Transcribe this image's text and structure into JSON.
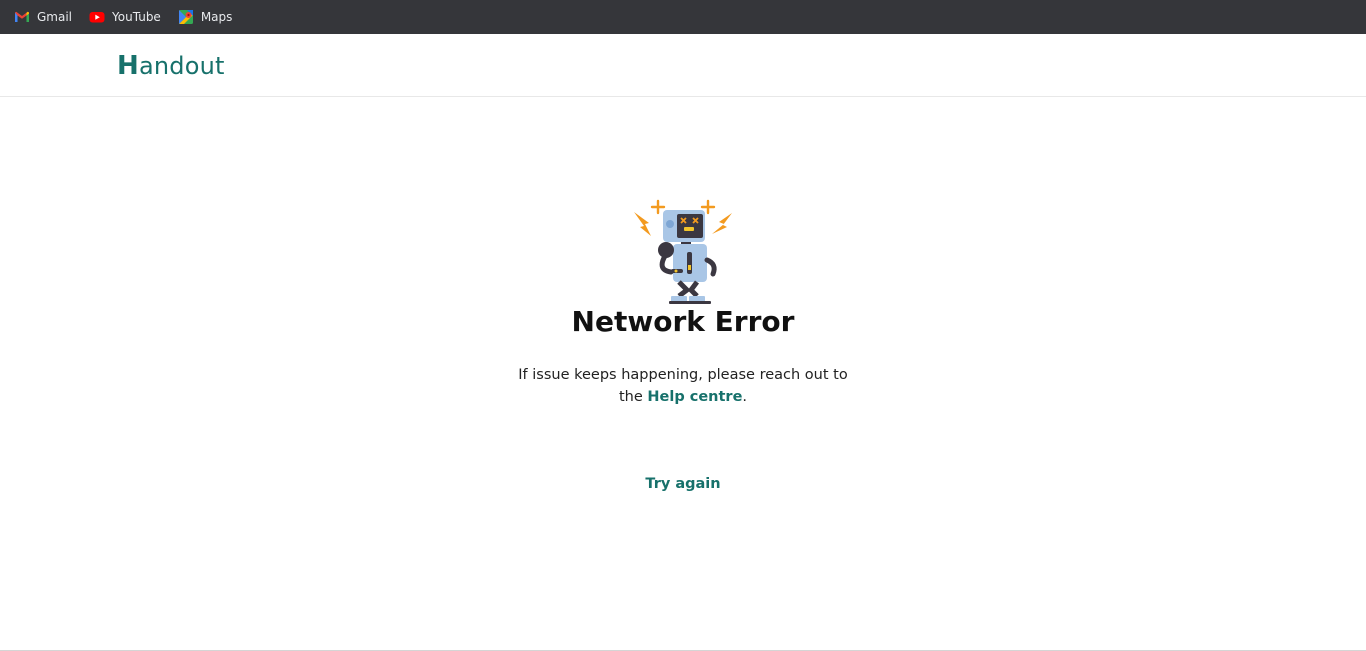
{
  "bookmarks": [
    {
      "label": "Gmail",
      "icon": "gmail-icon"
    },
    {
      "label": "YouTube",
      "icon": "youtube-icon"
    },
    {
      "label": "Maps",
      "icon": "maps-icon"
    }
  ],
  "header": {
    "logo_first": "H",
    "logo_rest": "andout"
  },
  "error": {
    "illustration": "broken-robot-icon",
    "title": "Network Error",
    "message_line1": "If issue keeps happening, please reach out to",
    "message_line2_prefix": "the ",
    "help_link": "Help centre",
    "message_line2_suffix": ".",
    "try_again": "Try again"
  },
  "colors": {
    "brand": "#17716b",
    "bookmarks_bar": "#35363a",
    "spark": "#f39a1f",
    "robot_body": "#a9c6e6",
    "robot_dark": "#3b3741"
  }
}
